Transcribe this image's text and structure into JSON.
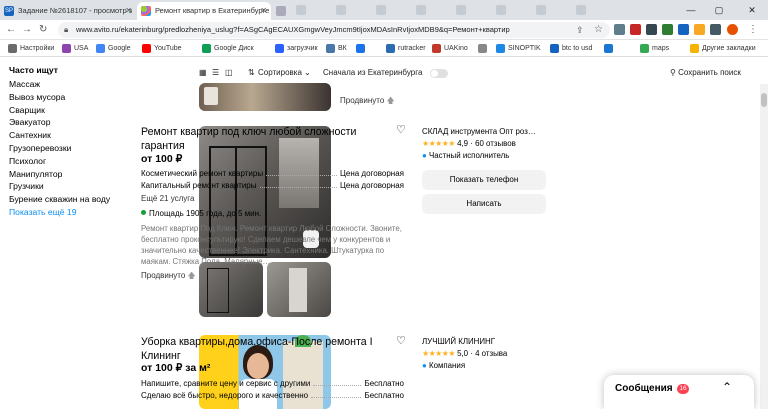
{
  "browser": {
    "tabs": [
      {
        "label": "Задание №2618107 - просмотр з"
      },
      {
        "label": "Ремонт квартир в Екатеринбурге"
      },
      {
        "label": ""
      }
    ],
    "url": "www.avito.ru/ekaterinburg/predlozheniya_uslug?f=ASgCAgECAUXGmgwVeyJmcm9tIjoxMDAsInRvIjoxMDB9&q=Ремонт+квартир",
    "bookmarks": [
      {
        "label": "Настройки",
        "color": "#6b6b6b"
      },
      {
        "label": "USA",
        "color": "#8e44ad"
      },
      {
        "label": "Google",
        "color": "#4285f4"
      },
      {
        "label": "YouTube",
        "color": "#ff0000"
      },
      {
        "label": "Google Диск",
        "color": "#0f9d58"
      },
      {
        "label": "загрузчик",
        "color": "#2962ff"
      },
      {
        "label": "ВК",
        "color": "#4a76a8"
      },
      {
        "label": "",
        "color": "#1a73e8"
      },
      {
        "label": "rutracker",
        "color": "#2b6cb0"
      },
      {
        "label": "UAKino",
        "color": "#c0392b"
      },
      {
        "label": "",
        "color": "#888"
      },
      {
        "label": "SINOPTIK",
        "color": "#1e88e5"
      },
      {
        "label": "btc to usd",
        "color": "#1565c0"
      },
      {
        "label": "",
        "color": "#1976d2"
      },
      {
        "label": "maps",
        "color": "#34a853"
      },
      {
        "label": "Другие закладки",
        "color": "#f4b400"
      }
    ]
  },
  "sidebar": {
    "heading": "Часто ищут",
    "items": [
      "Массаж",
      "Вывоз мусора",
      "Сварщик",
      "Эвакуатор",
      "Сантехник",
      "Грузоперевозки",
      "Психолог",
      "Манипулятор",
      "Грузчики",
      "Бурение скважин на воду"
    ],
    "more": "Показать ещё 19"
  },
  "toolbar": {
    "sort_label": "Сортировка",
    "city_first_label": "Сначала из Екатеринбурга",
    "save_search_label": "Сохранить поиск"
  },
  "prev_card": {
    "status": "Продвинуто"
  },
  "listings": [
    {
      "title_lines": [
        "Ремонт квартир под ключ любой сложности",
        "гарантия"
      ],
      "price": "от 100 ₽",
      "services": [
        {
          "name": "Косметический ремонт квартиры",
          "value": "Цена договорная"
        },
        {
          "name": "Капитальный ремонт квартиры",
          "value": "Цена договорная"
        }
      ],
      "more_services": "Ещё 21 услуга",
      "metro": "Площадь 1905 года, до 5 мин.",
      "metro_color": "#169c39",
      "description": "Ремонт квартир Под Ключ. Ремонт квартир Любой Сложности. Звоните, бесплатно проконсультирую! Сделаем дешевле чем у конкурентов и значительно качественнее! Электрика. Сантехника. Штукатурка по маякам. Стяжка Пола. Малярные…",
      "status": "Продвинуто",
      "seller": {
        "name": "СКЛАД инструмента Опт роз…",
        "rating": "4,9",
        "reviews": "60 отзывов",
        "badge": "Частный исполнитель"
      },
      "show_phone": "Показать телефон",
      "write": "Написать"
    },
    {
      "title_lines": [
        "Уборка квартиры,дома,офиса-После ремонта I",
        "Клининг"
      ],
      "price": "от 100 ₽ за м²",
      "services": [
        {
          "name": "Напишите, сравните цену и сервис с другими",
          "value": "Бесплатно"
        },
        {
          "name": "Сделаю всё быстро, недорого и качественно",
          "value": "Бесплатно"
        }
      ],
      "seller": {
        "name": "ЛУЧШИЙ КЛИНИНГ",
        "rating": "5,0",
        "reviews": "4 отзыва",
        "badge": "Компания"
      }
    }
  ],
  "messages": {
    "label": "Сообщения",
    "count": "16"
  },
  "colors": {
    "link": "#0a8ef5",
    "accent_check": "#0a8ef5",
    "star": "#ffb021"
  }
}
